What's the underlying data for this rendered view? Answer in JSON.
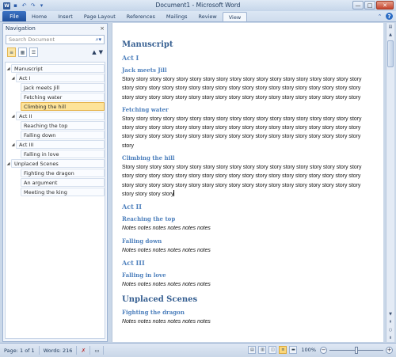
{
  "window": {
    "title": "Document1 - Microsoft Word",
    "controls": {
      "minimize": "—",
      "maximize": "□",
      "close": "✕"
    }
  },
  "qat_icons": [
    "word-app-icon",
    "save-icon",
    "undo-icon",
    "redo-icon",
    "customize-qat-icon"
  ],
  "ribbon": {
    "file_label": "File",
    "tabs": [
      "Home",
      "Insert",
      "Page Layout",
      "References",
      "Mailings",
      "Review",
      "View"
    ],
    "active_tab": "View"
  },
  "navigation": {
    "title": "Navigation",
    "close": "×",
    "search_placeholder": "Search Document",
    "tree": [
      {
        "label": "Manuscript",
        "level": 1,
        "expanded": true
      },
      {
        "label": "Act I",
        "level": 2,
        "expanded": true
      },
      {
        "label": "Jack meets Jill",
        "level": 3
      },
      {
        "label": "Fetching water",
        "level": 3
      },
      {
        "label": "Climbing the hill",
        "level": 3,
        "selected": true
      },
      {
        "label": "Act II",
        "level": 2,
        "expanded": true
      },
      {
        "label": "Reaching the top",
        "level": 3
      },
      {
        "label": "Falling down",
        "level": 3
      },
      {
        "label": "Act III",
        "level": 2,
        "expanded": true
      },
      {
        "label": "Falling in love",
        "level": 3
      },
      {
        "label": "Unplaced Scenes",
        "level": 1,
        "expanded": true
      },
      {
        "label": "Fighting the dragon",
        "level": 3
      },
      {
        "label": "An argument",
        "level": 3
      },
      {
        "label": "Meeting the king",
        "level": 3
      }
    ]
  },
  "document": {
    "title": "Manuscript",
    "acts": [
      {
        "heading": "Act I",
        "scenes": [
          {
            "heading": "Jack meets Jill",
            "text": "Story story story story story story story story story story story story story story story story story story story story story story story story story story story story story story story story story story story story story story story story story story story story story story story story story story story story story story"
          },
          {
            "heading": "Fetching water",
            "text": "Story story story story story story story story story story story story story story story story story story story story story story story story story story story story story story story story story story story story story story story story story story story story story story story story story story story story story story story"
          },
          {
            "heading": "Climbing the hill",
            "text": "Story story story story story story story story story story story story story story story story story story story story story story story story story story story story story story story story story story story story story story story story story story story story story story story story story story story story story story story story story story"
          }
        ]
      },
      {
        "heading": "Act II",
        "scenes": [
          {
            "heading": "Reaching the top",
            "text": "Notes notes notes notes notes notes"
          },
          {
            "heading": "Falling down",
            "text": "Notes notes notes notes notes notes"
          }
        ]
      },
      {
        "heading": "Act III",
        "scenes": [
          {
            "heading": "Falling in love",
            "text": "Notes notes notes notes notes notes"
          }
        ]
      }
    ],
    "unplaced": {
      "heading": "Unplaced Scenes",
      "scenes": [
        {
          "heading": "Fighting the dragon",
          "text": "Notes notes notes notes notes notes"
        }
      ]
    }
  },
  "status": {
    "page": "Page: 1 of 1",
    "words": "Words: 216",
    "zoom": "100%",
    "zoom_level": 1.0
  }
}
